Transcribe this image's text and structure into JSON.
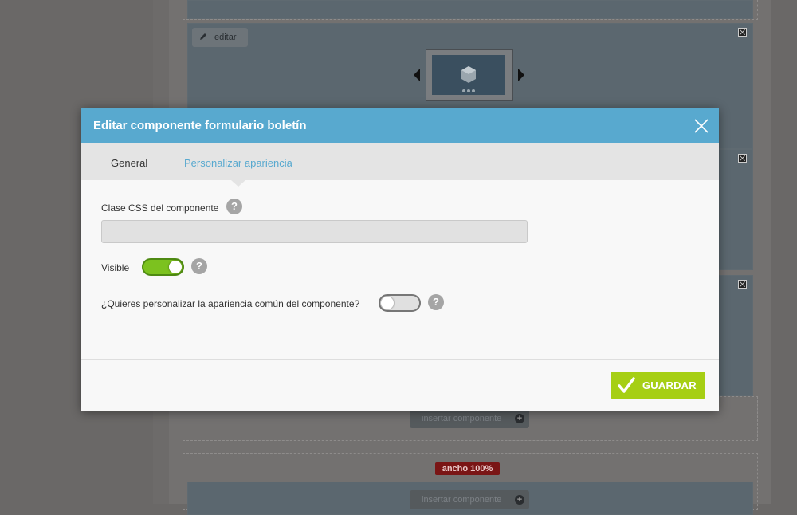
{
  "background": {
    "edit_label": "editar",
    "insert_label_1": "insertar componente",
    "insert_label_2": "insertar componente",
    "width_badge": "ancho 100%"
  },
  "modal": {
    "title": "Editar componente formulario boletín",
    "tabs": [
      {
        "label": "General",
        "active": false
      },
      {
        "label": "Personalizar apariencia",
        "active": true
      }
    ],
    "fields": {
      "css_class": {
        "label": "Clase CSS del componente",
        "value": "",
        "placeholder": ""
      },
      "visible": {
        "label": "Visible",
        "enabled": true
      },
      "customize": {
        "label": "¿Quieres personalizar la apariencia común del componente?",
        "enabled": false
      }
    },
    "help_glyph": "?",
    "save_label": "GUARDAR"
  },
  "colors": {
    "header": "#58a9cf",
    "active_tab": "#58a9cf",
    "save_button": "#a6cf14",
    "toggle_on": "#7cc21f",
    "badge": "#7a1515"
  }
}
